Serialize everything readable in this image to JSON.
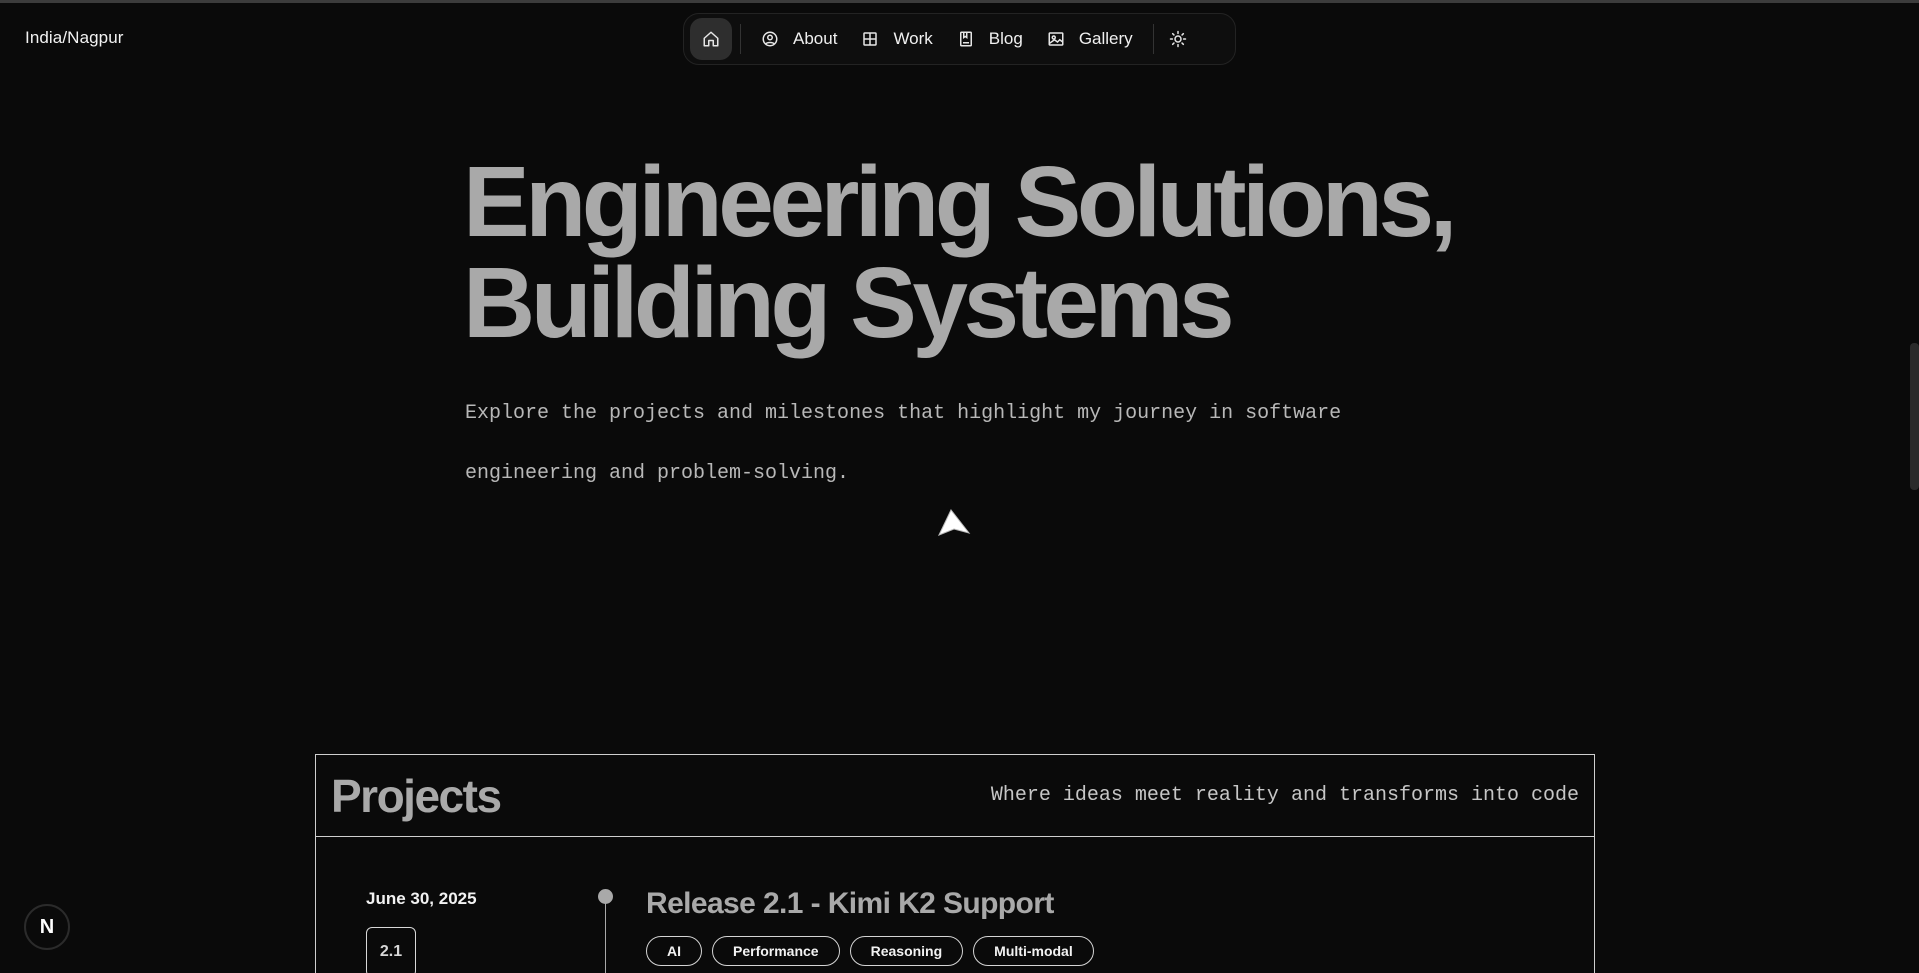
{
  "location": "India/Nagpur",
  "nav": {
    "home_icon": "home-icon",
    "items": [
      {
        "label": "About",
        "icon": "user-circle-icon"
      },
      {
        "label": "Work",
        "icon": "grid-icon"
      },
      {
        "label": "Blog",
        "icon": "book-icon"
      },
      {
        "label": "Gallery",
        "icon": "image-icon"
      }
    ],
    "theme_icon": "sun-icon"
  },
  "hero": {
    "title_line1": "Engineering Solutions,",
    "title_line2": "Building Systems",
    "subtitle": "Explore the projects and milestones that highlight my journey in software engineering and problem-solving."
  },
  "projects": {
    "title": "Projects",
    "tagline": "Where ideas meet reality and transforms into code",
    "releases": [
      {
        "date": "June 30, 2025",
        "version": "2.1",
        "title": "Release 2.1 - Kimi K2 Support",
        "tags": [
          "AI",
          "Performance",
          "Reasoning",
          "Multi-modal"
        ]
      }
    ]
  },
  "dev_badge": "N",
  "colors": {
    "background": "#0a0a0a",
    "heading": "#a9a9a9",
    "text": "#f2f2f2",
    "border": "#cfcfcf"
  }
}
